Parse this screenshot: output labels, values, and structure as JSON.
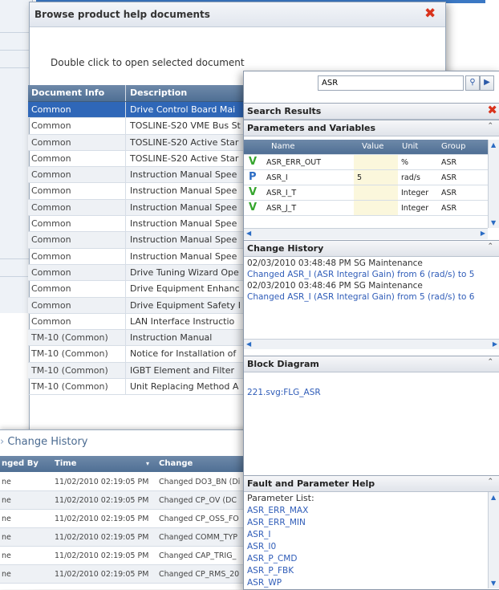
{
  "browse_dialog": {
    "title": "Browse product help documents",
    "instruction": "Double click to open selected document",
    "columns": [
      "Document Info",
      "Description"
    ],
    "rows": [
      [
        "Common",
        "Drive Control Board Mai"
      ],
      [
        "Common",
        "TOSLINE-S20 VME Bus St"
      ],
      [
        "Common",
        "TOSLINE-S20 Active Star"
      ],
      [
        "Common",
        "TOSLINE-S20 Active Star"
      ],
      [
        "Common",
        "Instruction Manual Spee"
      ],
      [
        "Common",
        "Instruction Manual Spee"
      ],
      [
        "Common",
        "Instruction Manual Spee"
      ],
      [
        "Common",
        "Instruction Manual Spee"
      ],
      [
        "Common",
        "Instruction Manual Spee"
      ],
      [
        "Common",
        "Instruction Manual Spee"
      ],
      [
        "Common",
        "Drive Tuning Wizard Ope"
      ],
      [
        "Common",
        "Drive Equipment Enhanc"
      ],
      [
        "Common",
        "Drive Equipment Safety I"
      ],
      [
        "Common",
        "LAN Interface Instructio"
      ],
      [
        "TM-10 (Common)",
        "Instruction Manual"
      ],
      [
        "TM-10 (Common)",
        "Notice for Installation of"
      ],
      [
        "TM-10 (Common)",
        "IGBT Element and Filter"
      ],
      [
        "TM-10 (Common)",
        "Unit Replacing Method A"
      ]
    ]
  },
  "change_history_panel": {
    "title": "Change History",
    "columns": [
      "nged By",
      "Time",
      "Change"
    ],
    "rows": [
      [
        "ne",
        "11/02/2010 02:19:05 PM",
        "Changed DO3_BN (Di"
      ],
      [
        "ne",
        "11/02/2010 02:19:05 PM",
        "Changed CP_OV (DC"
      ],
      [
        "ne",
        "11/02/2010 02:19:05 PM",
        "Changed CP_OSS_FO"
      ],
      [
        "ne",
        "11/02/2010 02:19:05 PM",
        "Changed COMM_TYP"
      ],
      [
        "ne",
        "11/02/2010 02:19:05 PM",
        "Changed CAP_TRIG_"
      ],
      [
        "ne",
        "11/02/2010 02:19:05 PM",
        "Changed CP_RMS_20"
      ]
    ]
  },
  "right_panel": {
    "search_value": "ASR",
    "search_results_title": "Search Results",
    "params_title": "Parameters and Variables",
    "param_columns": [
      "Name",
      "Value",
      "Unit",
      "Group"
    ],
    "params": [
      {
        "type": "V",
        "name": "ASR_ERR_OUT",
        "value": "",
        "unit": "%",
        "group": "ASR"
      },
      {
        "type": "P",
        "name": "ASR_I",
        "value": "5",
        "unit": "rad/s",
        "group": "ASR"
      },
      {
        "type": "V",
        "name": "ASR_I_T",
        "value": "",
        "unit": "Integer",
        "group": "ASR"
      },
      {
        "type": "V",
        "name": "ASR_J_T",
        "value": "",
        "unit": "Integer",
        "group": "ASR"
      }
    ],
    "change_history_title": "Change History",
    "history": [
      {
        "header": "02/03/2010 03:48:48 PM SG Maintenance",
        "detail": "Changed ASR_I (ASR Integral Gain) from 6 (rad/s) to 5"
      },
      {
        "header": "02/03/2010 03:48:46 PM SG Maintenance",
        "detail": "Changed ASR_I (ASR Integral Gain) from 5 (rad/s) to 6"
      }
    ],
    "block_diagram_title": "Block Diagram",
    "block_diagram_link": "221.svg:FLG_ASR",
    "fault_title": "Fault and Parameter Help",
    "param_list_label": "Parameter List:",
    "param_list": [
      "ASR_ERR_MAX",
      "ASR_ERR_MIN",
      "ASR_I",
      "ASR_I0",
      "ASR_P_CMD",
      "ASR_P_FBK",
      "ASR_WP"
    ]
  },
  "colors": {
    "accent": "#2f67b8",
    "header": "#5a7a9f",
    "close": "#d9331c",
    "link": "#2f5cb8"
  }
}
